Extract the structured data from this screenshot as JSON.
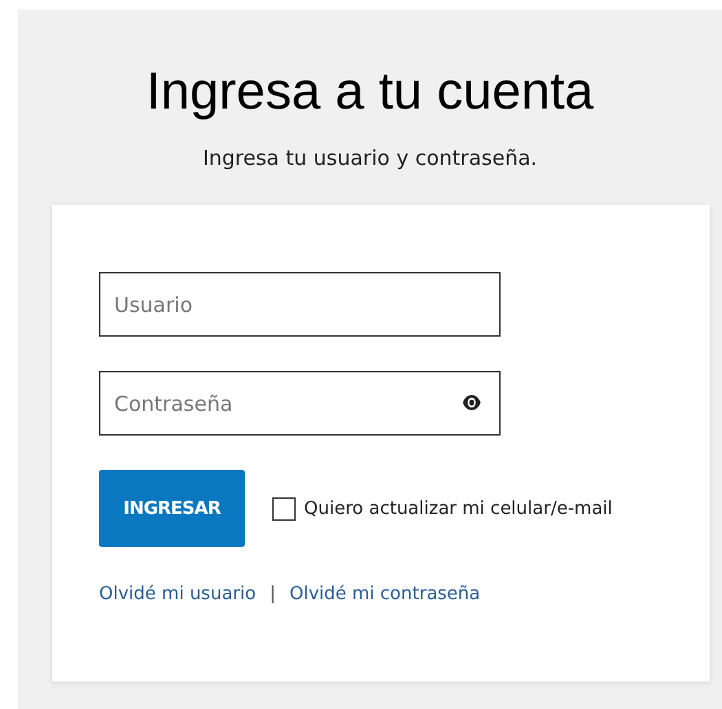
{
  "title": "Ingresa a tu cuenta",
  "subtitle": "Ingresa tu usuario y contraseña.",
  "fields": [
    {
      "kind": "text",
      "placeholder": "Usuario"
    },
    {
      "kind": "password",
      "placeholder": "Contraseña"
    }
  ],
  "submit_button": "INGRESAR",
  "update_checkbox": {
    "label": "Quiero actualizar mi celular/e-mail",
    "checked": false
  },
  "links": [
    "Olvidé mi usuario",
    "Olvidé mi contraseña"
  ],
  "link_separator": "|"
}
